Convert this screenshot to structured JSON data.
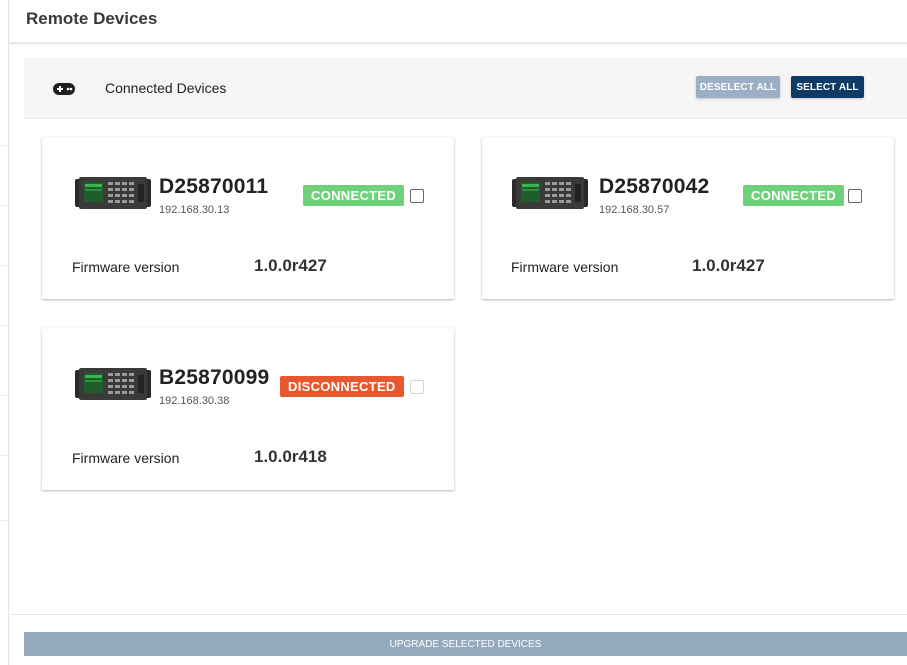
{
  "header": {
    "title": "Remote Devices"
  },
  "toolbar": {
    "title": "Connected Devices",
    "deselect_all_label": "DESELECT ALL",
    "select_all_label": "SELECT ALL"
  },
  "devices": [
    {
      "name": "D25870011",
      "ip": "192.168.30.13",
      "status": "CONNECTED",
      "firmware_label": "Firmware version",
      "firmware_version": "1.0.0r427",
      "checked": false,
      "enabled": true
    },
    {
      "name": "D25870042",
      "ip": "192.168.30.57",
      "status": "CONNECTED",
      "firmware_label": "Firmware version",
      "firmware_version": "1.0.0r427",
      "checked": false,
      "enabled": true
    },
    {
      "name": "B25870099",
      "ip": "192.168.30.38",
      "status": "DISCONNECTED",
      "firmware_label": "Firmware version",
      "firmware_version": "1.0.0r418",
      "checked": false,
      "enabled": false
    }
  ],
  "footer": {
    "upgrade_label": "UPGRADE SELECTED DEVICES"
  },
  "colors": {
    "connected": "#6fd27a",
    "disconnected": "#e8582f",
    "primary": "#0e3a66",
    "disabled_button": "#9bb0c4"
  },
  "icons": {
    "toolbar": "gamepad-icon",
    "device": "device-unit-image"
  }
}
